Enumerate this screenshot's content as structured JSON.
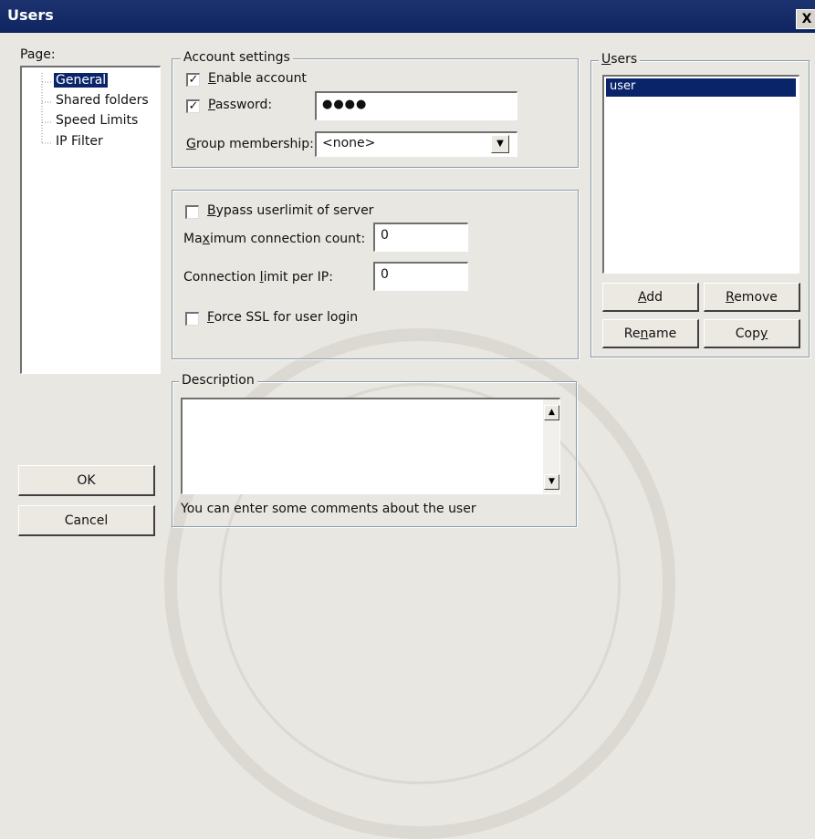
{
  "window": {
    "title": "Users",
    "close_label": "X"
  },
  "page_tree": {
    "label": "Page:",
    "items": [
      "General",
      "Shared folders",
      "Speed Limits",
      "IP Filter"
    ],
    "selected": "General"
  },
  "account_settings": {
    "legend": "Account settings",
    "enable_account": {
      "label": "Enable account",
      "checked": true
    },
    "password": {
      "label": "Password:",
      "checked": true,
      "value": "●●●●"
    },
    "group_membership": {
      "label": "Group membership:",
      "value": "<none>"
    }
  },
  "limits": {
    "bypass": {
      "label": "Bypass userlimit of server",
      "checked": false
    },
    "max_connections": {
      "label": "Maximum connection count:",
      "value": "0"
    },
    "per_ip": {
      "label": "Connection limit per IP:",
      "value": "0"
    },
    "force_ssl": {
      "label": "Force SSL for user login",
      "checked": false
    }
  },
  "description": {
    "legend": "Description",
    "value": "",
    "hint": "You can enter some comments about the user"
  },
  "users": {
    "legend": "Users",
    "items": [
      "user"
    ],
    "selected": "user",
    "add_label": "Add",
    "remove_label": "Remove",
    "rename_label": "Rename",
    "copy_label": "Copy"
  },
  "dialog": {
    "ok_label": "OK",
    "cancel_label": "Cancel"
  },
  "colors": {
    "titlebar": "#0f2560",
    "selection": "#0a246a",
    "face": "#e9e7e2"
  }
}
